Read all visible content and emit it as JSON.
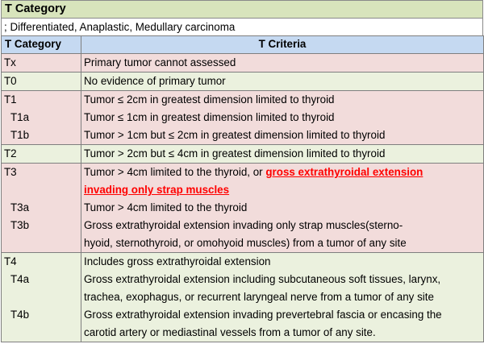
{
  "title": "T Category",
  "subtitle": "; Differentiated, Anaplastic, Medullary carcinoma",
  "headers": {
    "category": "T Category",
    "criteria": "T Criteria"
  },
  "rows": {
    "tx": {
      "cat": "Tx",
      "text": "Primary tumor cannot assessed"
    },
    "t0": {
      "cat": "T0",
      "text": "No evidence of primary tumor"
    },
    "t1": {
      "cat": "T1",
      "text": "Tumor ≤ 2cm in greatest dimension limited to thyroid",
      "t1a_cat": "T1a",
      "t1a_text": "Tumor ≤ 1cm in greatest dimension limited to thyroid",
      "t1b_cat": "T1b",
      "t1b_text": "Tumor > 1cm but ≤ 2cm in greatest dimension limited to thyroid"
    },
    "t2": {
      "cat": "T2",
      "text": "Tumor > 2cm but ≤ 4cm in greatest dimension limited to thyroid"
    },
    "t3": {
      "cat": "T3",
      "text_plain": "Tumor > 4cm limited to the thyroid, or ",
      "text_hl_1": "gross extrathyroidal extension",
      "text_hl_2": "invading only strap muscles",
      "t3a_cat": "T3a",
      "t3a_text": "Tumor > 4cm limited to the thyroid",
      "t3b_cat": "T3b",
      "t3b_text_1": "Gross extrathyroidal extension invading only strap muscles(sterno-",
      "t3b_text_2": "hyoid, sternothyroid, or omohyoid muscles) from a tumor of any site"
    },
    "t4": {
      "cat": "T4",
      "text": "Includes gross extrathyroidal extension",
      "t4a_cat": "T4a",
      "t4a_text_1": "Gross extrathyroidal extension including subcutaneous soft tissues, larynx,",
      "t4a_text_2": "trachea, exophagus, or recurrent laryngeal nerve from a tumor of any site",
      "t4b_cat": "T4b",
      "t4b_text_1": "Gross extrathyroidal extension invading prevertebral fascia or encasing the",
      "t4b_text_2": "carotid artery or mediastinal vessels from a tumor of any site."
    }
  },
  "colors": {
    "title_bg": "#d8e4bc",
    "header_bg": "#c5d9f1",
    "pink_row": "#f2dcdb",
    "green_row": "#ebf1de",
    "highlight": "#ff0000"
  }
}
